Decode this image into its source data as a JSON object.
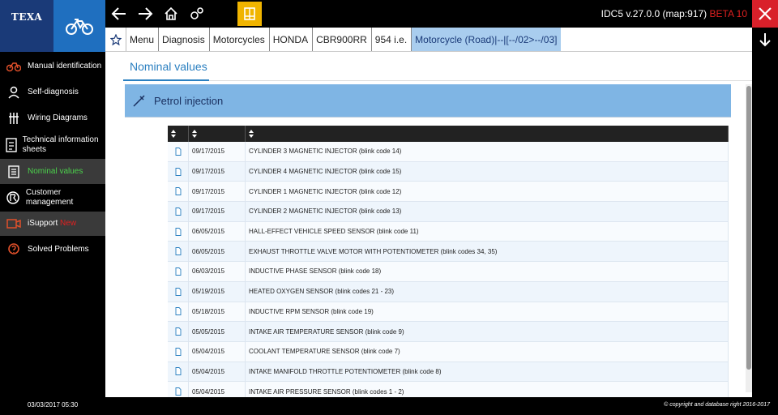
{
  "app": {
    "logo_text": "TEXA",
    "version": "IDC5 v.27.0.0 (map:917)",
    "beta": "BETA 10"
  },
  "breadcrumb": [
    "Menu",
    "Diagnosis",
    "Motorcycles",
    "HONDA",
    "CBR900RR",
    "954 i.e.",
    "Motorcycle (Road)|--|[--/02>--/03]"
  ],
  "sidebar": [
    {
      "label": "Manual identification",
      "icon": "motorcycle-icon"
    },
    {
      "label": "Self-diagnosis",
      "icon": "person-icon"
    },
    {
      "label": "Wiring Diagrams",
      "icon": "wiring-icon"
    },
    {
      "label": "Technical information sheets",
      "icon": "info-sheet-icon"
    },
    {
      "label": "Nominal values",
      "icon": "nominal-values-icon"
    },
    {
      "label": "Customer management",
      "icon": "customer-icon"
    },
    {
      "label": "iSupport",
      "badge": "New",
      "icon": "isupport-icon"
    },
    {
      "label": "Solved Problems",
      "icon": "solved-problems-icon"
    }
  ],
  "main": {
    "tab": "Nominal values",
    "section_title": "Petrol injection"
  },
  "table": {
    "rows": [
      {
        "date": "09/17/2015",
        "desc": "CYLINDER 3 MAGNETIC INJECTOR (blink code 14)"
      },
      {
        "date": "09/17/2015",
        "desc": "CYLINDER 4 MAGNETIC INJECTOR (blink code 15)"
      },
      {
        "date": "09/17/2015",
        "desc": "CYLINDER 1 MAGNETIC INJECTOR (blink code 12)"
      },
      {
        "date": "09/17/2015",
        "desc": "CYLINDER 2 MAGNETIC INJECTOR (blink code 13)"
      },
      {
        "date": "06/05/2015",
        "desc": "HALL-EFFECT VEHICLE SPEED SENSOR (blink code 11)"
      },
      {
        "date": "06/05/2015",
        "desc": "EXHAUST THROTTLE VALVE MOTOR WITH POTENTIOMETER (blink codes 34, 35)"
      },
      {
        "date": "06/03/2015",
        "desc": "INDUCTIVE PHASE SENSOR (blink code 18)"
      },
      {
        "date": "05/19/2015",
        "desc": "HEATED OXYGEN SENSOR (blink codes 21 - 23)"
      },
      {
        "date": "05/18/2015",
        "desc": "INDUCTIVE RPM SENSOR (blink code 19)"
      },
      {
        "date": "05/05/2015",
        "desc": "INTAKE AIR TEMPERATURE SENSOR (blink code 9)"
      },
      {
        "date": "05/04/2015",
        "desc": "COOLANT TEMPERATURE SENSOR (blink code 7)"
      },
      {
        "date": "05/04/2015",
        "desc": "INTAKE MANIFOLD THROTTLE POTENTIOMETER (blink code 8)"
      },
      {
        "date": "05/04/2015",
        "desc": "INTAKE AIR PRESSURE SENSOR (blink codes 1 - 2)"
      }
    ]
  },
  "footer": {
    "datetime": "03/03/2017 05:30",
    "copyright": "© copyright and database right 2016-2017"
  },
  "colors": {
    "brand_dark": "#1a3a78",
    "brand_blue": "#1f6fbf",
    "accent_yellow": "#f0b400",
    "close_red": "#d9202a",
    "active_green": "#4cd24c",
    "section_blue": "#7fb5e4"
  }
}
